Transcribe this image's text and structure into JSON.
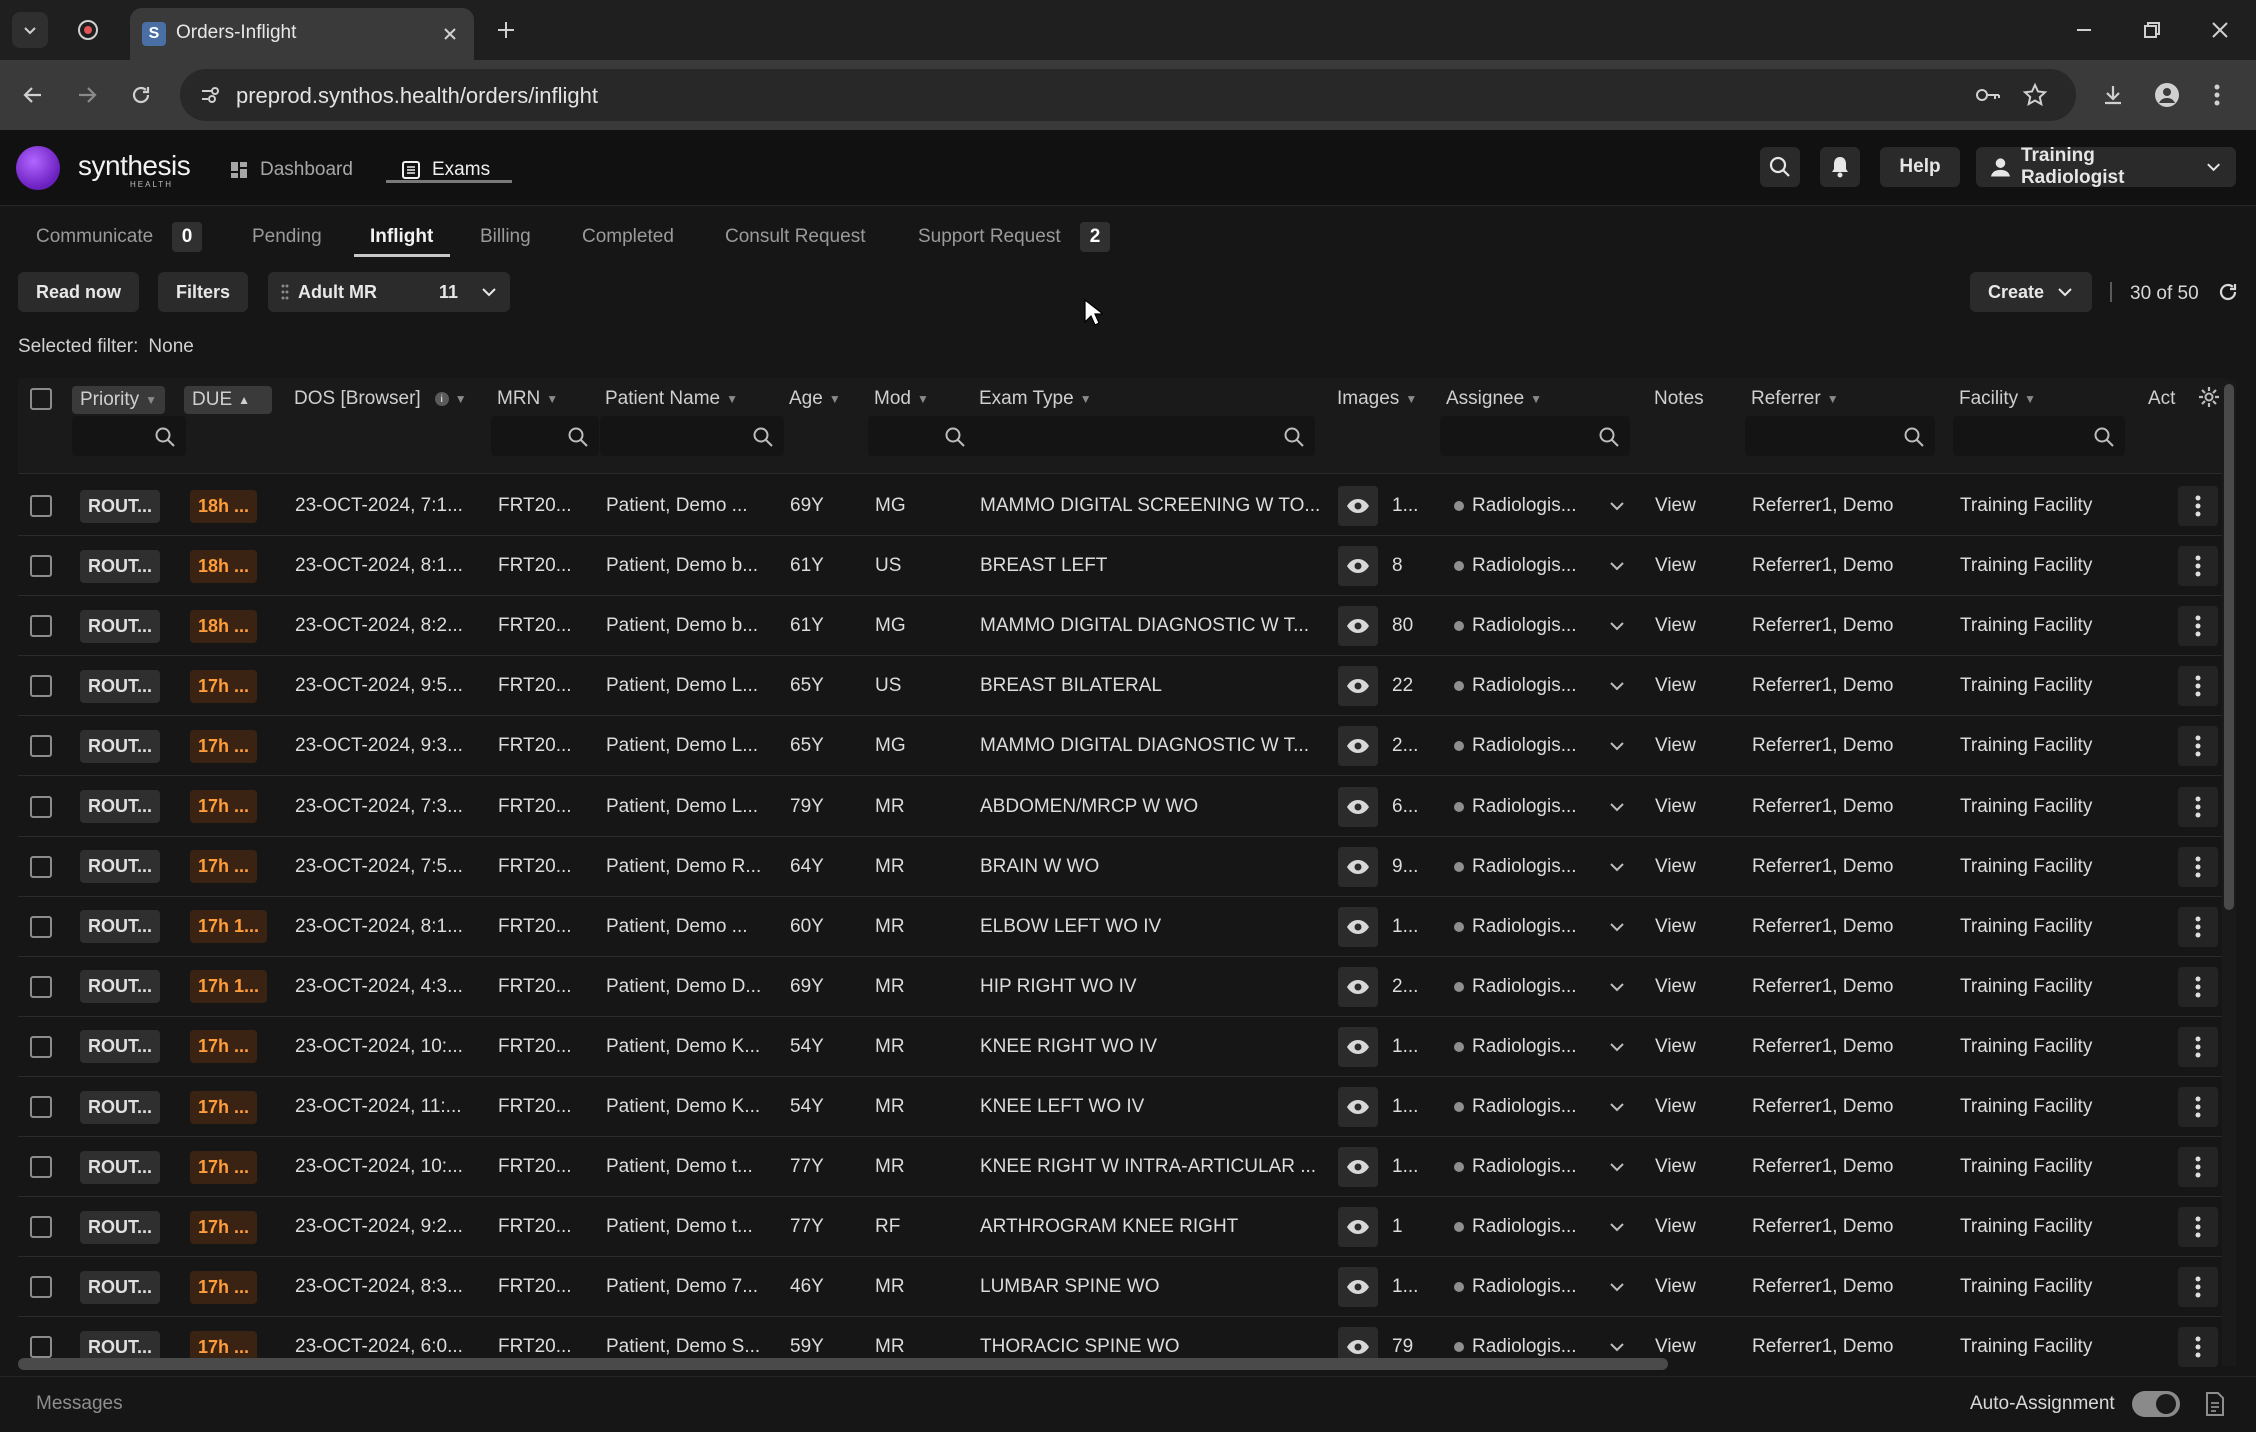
{
  "browser": {
    "tab_title": "Orders-Inflight",
    "url": "preprod.synthos.health/orders/inflight"
  },
  "app": {
    "brand": "synthesis",
    "brand_sub": "HEALTH",
    "nav": {
      "dashboard": "Dashboard",
      "exams": "Exams"
    },
    "help": "Help",
    "user": "Training Radiologist"
  },
  "subtabs": {
    "communicate": "Communicate",
    "communicate_count": "0",
    "pending": "Pending",
    "inflight": "Inflight",
    "billing": "Billing",
    "completed": "Completed",
    "consult_request": "Consult Request",
    "support_request": "Support Request",
    "support_request_count": "2"
  },
  "toolbar": {
    "read_now": "Read now",
    "filters": "Filters",
    "worklist": "Adult MR",
    "worklist_count": "11",
    "create": "Create",
    "pagination": "30 of 50"
  },
  "selected_filter": {
    "label": "Selected filter:",
    "value": "None"
  },
  "columns": {
    "priority": "Priority",
    "due": "DUE",
    "dos": "DOS [Browser]",
    "mrn": "MRN",
    "patient_name": "Patient Name",
    "age": "Age",
    "mod": "Mod",
    "exam_type": "Exam Type",
    "images": "Images",
    "assignee": "Assignee",
    "notes": "Notes",
    "referrer": "Referrer",
    "facility": "Facility",
    "act": "Act"
  },
  "rows": [
    {
      "priority": "ROUT...",
      "due": "18h ...",
      "dos": "23-OCT-2024, 7:1...",
      "mrn": "FRT20...",
      "patient": "Patient, Demo ...",
      "age": "69Y",
      "mod": "MG",
      "exam": "MAMMO DIGITAL SCREENING W TO...",
      "images": "1...",
      "assignee": "Radiologis...",
      "notes": "View",
      "referrer": "Referrer1, Demo",
      "facility": "Training Facility"
    },
    {
      "priority": "ROUT...",
      "due": "18h ...",
      "dos": "23-OCT-2024, 8:1...",
      "mrn": "FRT20...",
      "patient": "Patient, Demo b...",
      "age": "61Y",
      "mod": "US",
      "exam": "BREAST LEFT",
      "images": "8",
      "assignee": "Radiologis...",
      "notes": "View",
      "referrer": "Referrer1, Demo",
      "facility": "Training Facility"
    },
    {
      "priority": "ROUT...",
      "due": "18h ...",
      "dos": "23-OCT-2024, 8:2...",
      "mrn": "FRT20...",
      "patient": "Patient, Demo b...",
      "age": "61Y",
      "mod": "MG",
      "exam": "MAMMO DIGITAL DIAGNOSTIC W T...",
      "images": "80",
      "assignee": "Radiologis...",
      "notes": "View",
      "referrer": "Referrer1, Demo",
      "facility": "Training Facility"
    },
    {
      "priority": "ROUT...",
      "due": "17h ...",
      "dos": "23-OCT-2024, 9:5...",
      "mrn": "FRT20...",
      "patient": "Patient, Demo L...",
      "age": "65Y",
      "mod": "US",
      "exam": "BREAST BILATERAL",
      "images": "22",
      "assignee": "Radiologis...",
      "notes": "View",
      "referrer": "Referrer1, Demo",
      "facility": "Training Facility"
    },
    {
      "priority": "ROUT...",
      "due": "17h ...",
      "dos": "23-OCT-2024, 9:3...",
      "mrn": "FRT20...",
      "patient": "Patient, Demo L...",
      "age": "65Y",
      "mod": "MG",
      "exam": "MAMMO DIGITAL DIAGNOSTIC W T...",
      "images": "2...",
      "assignee": "Radiologis...",
      "notes": "View",
      "referrer": "Referrer1, Demo",
      "facility": "Training Facility"
    },
    {
      "priority": "ROUT...",
      "due": "17h ...",
      "dos": "23-OCT-2024, 7:3...",
      "mrn": "FRT20...",
      "patient": "Patient, Demo L...",
      "age": "79Y",
      "mod": "MR",
      "exam": "ABDOMEN/MRCP W WO",
      "images": "6...",
      "assignee": "Radiologis...",
      "notes": "View",
      "referrer": "Referrer1, Demo",
      "facility": "Training Facility"
    },
    {
      "priority": "ROUT...",
      "due": "17h ...",
      "dos": "23-OCT-2024, 7:5...",
      "mrn": "FRT20...",
      "patient": "Patient, Demo R...",
      "age": "64Y",
      "mod": "MR",
      "exam": "BRAIN W WO",
      "images": "9...",
      "assignee": "Radiologis...",
      "notes": "View",
      "referrer": "Referrer1, Demo",
      "facility": "Training Facility"
    },
    {
      "priority": "ROUT...",
      "due": "17h 1...",
      "dos": "23-OCT-2024, 8:1...",
      "mrn": "FRT20...",
      "patient": "Patient, Demo ...",
      "age": "60Y",
      "mod": "MR",
      "exam": "ELBOW LEFT WO IV",
      "images": "1...",
      "assignee": "Radiologis...",
      "notes": "View",
      "referrer": "Referrer1, Demo",
      "facility": "Training Facility"
    },
    {
      "priority": "ROUT...",
      "due": "17h 1...",
      "dos": "23-OCT-2024, 4:3...",
      "mrn": "FRT20...",
      "patient": "Patient, Demo D...",
      "age": "69Y",
      "mod": "MR",
      "exam": "HIP RIGHT WO IV",
      "images": "2...",
      "assignee": "Radiologis...",
      "notes": "View",
      "referrer": "Referrer1, Demo",
      "facility": "Training Facility"
    },
    {
      "priority": "ROUT...",
      "due": "17h ...",
      "dos": "23-OCT-2024, 10:...",
      "mrn": "FRT20...",
      "patient": "Patient, Demo K...",
      "age": "54Y",
      "mod": "MR",
      "exam": "KNEE RIGHT WO IV",
      "images": "1...",
      "assignee": "Radiologis...",
      "notes": "View",
      "referrer": "Referrer1, Demo",
      "facility": "Training Facility"
    },
    {
      "priority": "ROUT...",
      "due": "17h ...",
      "dos": "23-OCT-2024, 11:...",
      "mrn": "FRT20...",
      "patient": "Patient, Demo K...",
      "age": "54Y",
      "mod": "MR",
      "exam": "KNEE LEFT WO IV",
      "images": "1...",
      "assignee": "Radiologis...",
      "notes": "View",
      "referrer": "Referrer1, Demo",
      "facility": "Training Facility"
    },
    {
      "priority": "ROUT...",
      "due": "17h ...",
      "dos": "23-OCT-2024, 10:...",
      "mrn": "FRT20...",
      "patient": "Patient, Demo t...",
      "age": "77Y",
      "mod": "MR",
      "exam": "KNEE RIGHT W INTRA-ARTICULAR ...",
      "images": "1...",
      "assignee": "Radiologis...",
      "notes": "View",
      "referrer": "Referrer1, Demo",
      "facility": "Training Facility"
    },
    {
      "priority": "ROUT...",
      "due": "17h ...",
      "dos": "23-OCT-2024, 9:2...",
      "mrn": "FRT20...",
      "patient": "Patient, Demo t...",
      "age": "77Y",
      "mod": "RF",
      "exam": "ARTHROGRAM KNEE RIGHT",
      "images": "1",
      "assignee": "Radiologis...",
      "notes": "View",
      "referrer": "Referrer1, Demo",
      "facility": "Training Facility"
    },
    {
      "priority": "ROUT...",
      "due": "17h ...",
      "dos": "23-OCT-2024, 8:3...",
      "mrn": "FRT20...",
      "patient": "Patient, Demo 7...",
      "age": "46Y",
      "mod": "MR",
      "exam": "LUMBAR SPINE WO",
      "images": "1...",
      "assignee": "Radiologis...",
      "notes": "View",
      "referrer": "Referrer1, Demo",
      "facility": "Training Facility"
    },
    {
      "priority": "ROUT...",
      "due": "17h ...",
      "dos": "23-OCT-2024, 6:0...",
      "mrn": "FRT20...",
      "patient": "Patient, Demo S...",
      "age": "59Y",
      "mod": "MR",
      "exam": "THORACIC SPINE WO",
      "images": "79",
      "assignee": "Radiologis...",
      "notes": "View",
      "referrer": "Referrer1, Demo",
      "facility": "Training Facility"
    }
  ],
  "footer": {
    "messages": "Messages",
    "auto_assignment": "Auto-Assignment",
    "auto_assignment_on": true
  },
  "colors": {
    "accent_purple": "#7b2fd0",
    "due_orange": "#ff9d3a",
    "background": "#161616"
  }
}
